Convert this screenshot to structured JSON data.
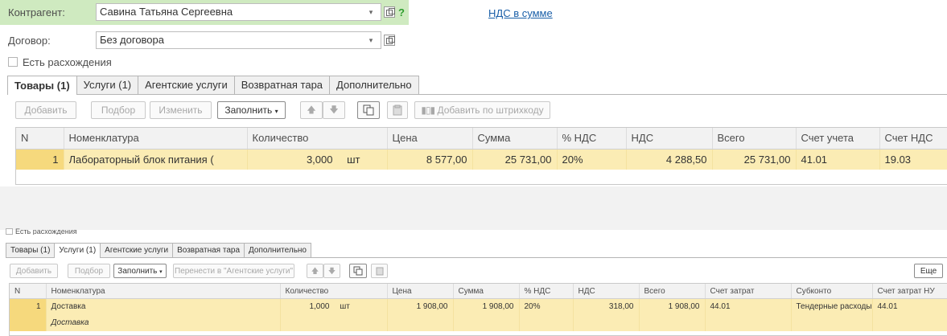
{
  "top": {
    "contractor": {
      "label": "Контрагент:",
      "value": "Савина Татьяна Сергеевна",
      "help": "?"
    },
    "vat_link": "НДС в сумме",
    "contract": {
      "label": "Договор:",
      "value": "Без договора"
    },
    "discrepancy_label": "Есть расхождения",
    "tabs": [
      "Товары (1)",
      "Услуги (1)",
      "Агентские услуги",
      "Возвратная тара",
      "Дополнительно"
    ],
    "toolbar": {
      "add": "Добавить",
      "pick": "Подбор",
      "edit": "Изменить",
      "fill": "Заполнить",
      "barcode": "Добавить по штрихкоду"
    },
    "table": {
      "columns": [
        "N",
        "Номенклатура",
        "Количество",
        "Цена",
        "Сумма",
        "% НДС",
        "НДС",
        "Всего",
        "Счет учета",
        "Счет НДС"
      ],
      "row": {
        "n": "1",
        "item": "Лабораторный блок питания (и...",
        "qty": "3,000",
        "unit": "шт",
        "price": "8 577,00",
        "sum": "25 731,00",
        "vat_rate": "20%",
        "vat": "4 288,50",
        "total": "25 731,00",
        "account": "41.01",
        "vat_account": "19.03"
      }
    }
  },
  "bottom": {
    "discrepancy_label": "Есть расхождения",
    "tabs": [
      "Товары (1)",
      "Услуги (1)",
      "Агентские услуги",
      "Возвратная тара",
      "Дополнительно"
    ],
    "toolbar": {
      "add": "Добавить",
      "pick": "Подбор",
      "fill": "Заполнить",
      "move": "Перенести в \"Агентские услуги\"",
      "more": "Еще"
    },
    "table": {
      "columns": [
        "N",
        "Номенклатура",
        "Количество",
        "Цена",
        "Сумма",
        "% НДС",
        "НДС",
        "Всего",
        "Счет затрат",
        "Субконто",
        "Счет затрат НУ"
      ],
      "row": {
        "n": "1",
        "item": "Доставка",
        "item_sub": "Доставка",
        "qty": "1,000",
        "unit": "шт",
        "price": "1 908,00",
        "sum": "1 908,00",
        "vat_rate": "20%",
        "vat": "318,00",
        "total": "1 908,00",
        "cost_account": "44.01",
        "subconto": "Тендерные расходы",
        "cost_account_nu": "44.01"
      }
    }
  }
}
